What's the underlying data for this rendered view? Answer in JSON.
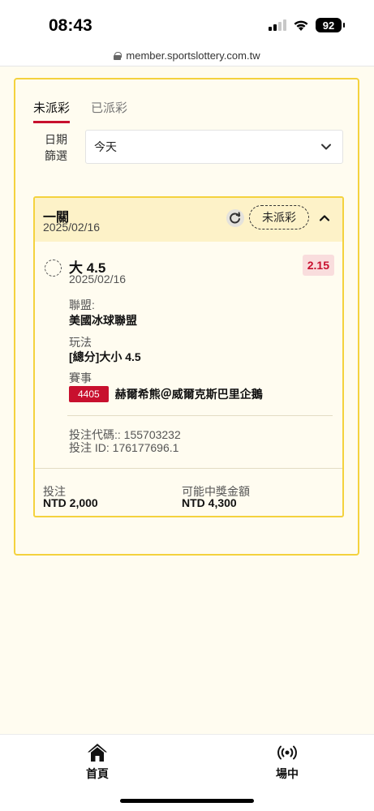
{
  "status_bar": {
    "time": "08:43",
    "battery": "92"
  },
  "browser": {
    "url": "member.sportslottery.com.tw"
  },
  "tabs": [
    {
      "label": "未派彩",
      "active": true
    },
    {
      "label": "已派彩",
      "active": false
    }
  ],
  "filter": {
    "label_line1": "日期",
    "label_line2": "篩選",
    "selected": "今天"
  },
  "bet": {
    "type": "一關",
    "date": "2025/02/16",
    "status": "未派彩",
    "selection": {
      "name": "大 4.5",
      "date": "2025/02/16",
      "odds": "2.15",
      "league_label": "聯盟:",
      "league_value": "美國冰球聯盟",
      "play_label": "玩法",
      "play_value": "[總分]大小 4.5",
      "event_label": "賽事",
      "event_code": "4405",
      "event_name": "赫爾希熊＠威爾克斯巴里企鵝"
    },
    "bet_code": "投注代碼:: 155703232",
    "bet_id": "投注 ID: 176177696.1",
    "stake_label": "投注",
    "stake_value": "NTD 2,000",
    "payout_label": "可能中獎金額",
    "payout_value": "NTD 4,300"
  },
  "bottom_nav": [
    {
      "label": "首頁",
      "icon": "home-icon"
    },
    {
      "label": "場中",
      "icon": "live-broadcast-icon"
    }
  ],
  "colors": {
    "accent_red": "#c8102e",
    "border_yellow": "#f4d23e",
    "header_yellow": "#fdf2c8",
    "page_bg": "#fffcf0"
  }
}
